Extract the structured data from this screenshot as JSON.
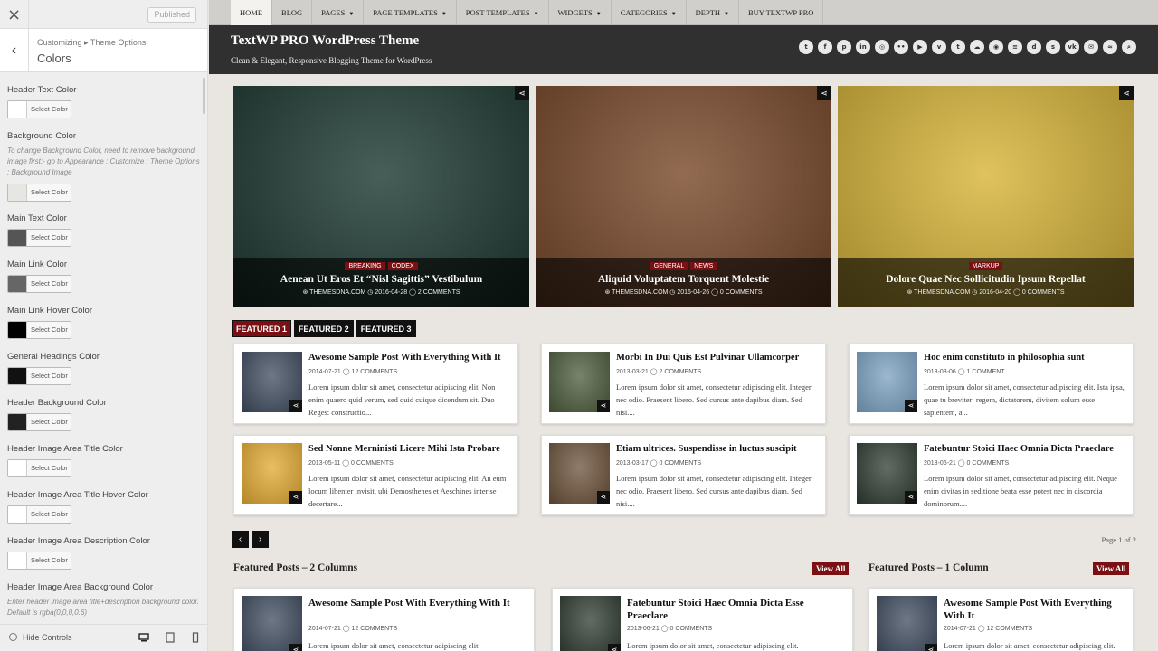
{
  "customizer": {
    "close_label": "×",
    "published_label": "Published",
    "back_label": "‹",
    "breadcrumb_path": "Customizing ▸ Theme Options",
    "section_title": "Colors",
    "select_color_label": "Select Color",
    "controls": [
      {
        "label": "Header Text Color",
        "color": "#ffffff"
      },
      {
        "label": "Background Color",
        "description": "To change Background Color, need to remove background image first:- go to Appearance : Customize : Theme Options : Background Image",
        "color": "#e8e6e2"
      },
      {
        "label": "Main Text Color",
        "color": "#555555"
      },
      {
        "label": "Main Link Color",
        "color": "#666666"
      },
      {
        "label": "Main Link Hover Color",
        "color": "#000000"
      },
      {
        "label": "General Headings Color",
        "color": "#111111"
      },
      {
        "label": "Header Background Color",
        "color": "#222222"
      },
      {
        "label": "Header Image Area Title Color",
        "color": "#ffffff"
      },
      {
        "label": "Header Image Area Title Hover Color",
        "color": "#ffffff"
      },
      {
        "label": "Header Image Area Description Color",
        "color": "#ffffff"
      },
      {
        "label": "Header Image Area Background Color",
        "description": "Enter header image area title+description background color. Default is rgba(0,0,0,0.6)"
      }
    ],
    "hide_controls_label": "Hide Controls"
  },
  "nav": {
    "items": [
      {
        "label": "HOME",
        "caret": false
      },
      {
        "label": "BLOG",
        "caret": false
      },
      {
        "label": "PAGES",
        "caret": true
      },
      {
        "label": "PAGE TEMPLATES",
        "caret": true
      },
      {
        "label": "POST TEMPLATES",
        "caret": true
      },
      {
        "label": "WIDGETS",
        "caret": true
      },
      {
        "label": "CATEGORIES",
        "caret": true
      },
      {
        "label": "DEPTH",
        "caret": true
      },
      {
        "label": "BUY TEXTWP PRO",
        "caret": false
      }
    ]
  },
  "header": {
    "title": "TextWP PRO WordPress Theme",
    "description": "Clean & Elegant, Responsive Blogging Theme for WordPress",
    "social_icons": [
      "twitter-icon",
      "facebook-icon",
      "pinterest-icon",
      "linkedin-icon",
      "instagram-icon",
      "flickr-icon",
      "youtube-icon",
      "vimeo-icon",
      "tumblr-icon",
      "soundcloud-icon",
      "github-icon",
      "slideshare-icon",
      "digg-icon",
      "stumbleupon-icon",
      "vk-icon",
      "email-icon",
      "rss-icon",
      "search-icon"
    ]
  },
  "slides": [
    {
      "categories": [
        "BREAKING",
        "CODEX"
      ],
      "title": "Aenean Ut Eros Et “Nisl Sagittis” Vestibulum",
      "meta": "⊛ THEMESDNA.COM  ◷ 2016-04-28  ◯ 2 COMMENTS",
      "bg": "#1f3a33"
    },
    {
      "categories": [
        "GENERAL",
        "NEWS"
      ],
      "title": "Aliquid Voluptatem Torquent Molestie",
      "meta": "⊛ THEMESDNA.COM  ◷ 2016-04-26  ◯ 0 COMMENTS",
      "bg": "#7a4a2c"
    },
    {
      "categories": [
        "MARKUP"
      ],
      "title": "Dolore Quae Nec Sollicitudin Ipsum Repellat",
      "meta": "⊛ THEMESDNA.COM  ◷ 2016-04-20  ◯ 0 COMMENTS",
      "bg": "#d8b53a"
    }
  ],
  "featured_tabs": [
    "FEATURED 1",
    "FEATURED 2",
    "FEATURED 3"
  ],
  "posts": [
    {
      "title": "Awesome Sample Post With Everything With It",
      "date": "2014-07-21",
      "comments": "12 COMMENTS",
      "excerpt": "Lorem ipsum dolor sit amet, consectetur adipiscing elit. Non enim quaero quid verum, sed quid cuique dicendum sit. Duo Reges: constructio...",
      "bg": "#3d4a5e"
    },
    {
      "title": "Morbi In Dui Quis Est Pulvinar Ullamcorper",
      "date": "2013-03-21",
      "comments": "2 COMMENTS",
      "excerpt": "Lorem ipsum dolor sit amet, consectetur adipiscing elit. Integer nec odio. Praesent libero. Sed cursus ante dapibus diam. Sed nisi....",
      "bg": "#4a5a3a"
    },
    {
      "title": "Hoc enim constituto in philosophia sunt",
      "date": "2013-03-06",
      "comments": "1 COMMENT",
      "excerpt": "Lorem ipsum dolor sit amet, consectetur adipiscing elit. Ista ipsa, quae tu breviter: regem, dictatorem, divitem solum esse sapientem, a...",
      "bg": "#7aa0c0"
    },
    {
      "title": "Sed Nonne Merninisti Licere Mihi Ista Probare",
      "date": "2013-05-11",
      "comments": "0 COMMENTS",
      "excerpt": "Lorem ipsum dolor sit amet, consectetur adipiscing elit. An eum locum libenter invisit, ubi Demosthenes et Aeschines inter se decertare...",
      "bg": "#e0a830"
    },
    {
      "title": "Etiam ultrices. Suspendisse in luctus suscipit",
      "date": "2013-03-17",
      "comments": "0 COMMENTS",
      "excerpt": "Lorem ipsum dolor sit amet, consectetur adipiscing elit. Integer nec odio. Praesent libero. Sed cursus ante dapibus diam. Sed nisi....",
      "bg": "#6a5038"
    },
    {
      "title": "Fatebuntur Stoici Haec Omnia Dicta Praeclare",
      "date": "2013-06-21",
      "comments": "0 COMMENTS",
      "excerpt": "Lorem ipsum dolor sit amet, consectetur adipiscing elit. Neque enim civitas in seditione beata esse potest nec in discordia dominorum....",
      "bg": "#2e3a30"
    }
  ],
  "pagination": {
    "prev": "‹",
    "next": "›",
    "info": "Page 1 of 2"
  },
  "sections": [
    {
      "title": "Featured Posts – 2 Columns",
      "view_all": "View All"
    },
    {
      "title": "Featured Posts – 1 Column",
      "view_all": "View All"
    }
  ],
  "bottom_posts": [
    {
      "title": "Awesome Sample Post With Everything With It",
      "date": "2014-07-21",
      "comments": "12 COMMENTS",
      "excerpt": "Lorem ipsum dolor sit amet, consectetur adipiscing elit.",
      "bg": "#3d4a5e"
    },
    {
      "title": "Fatebuntur Stoici Haec Omnia Dicta Esse Praeclare",
      "date": "2013-06-21",
      "comments": "0 COMMENTS",
      "excerpt": "Lorem ipsum dolor sit amet, consectetur adipiscing elit.",
      "bg": "#2e3a30"
    },
    {
      "title": "Awesome Sample Post With Everything With It",
      "date": "2014-07-21",
      "comments": "12 COMMENTS",
      "excerpt": "Lorem ipsum dolor sit amet, consectetur adipiscing elit.",
      "bg": "#3d4a5e"
    }
  ]
}
